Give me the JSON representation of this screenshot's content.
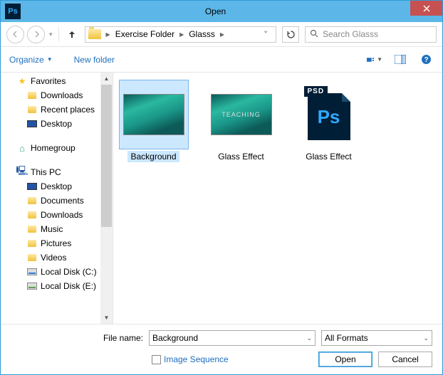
{
  "title": "Open",
  "breadcrumb": {
    "seg1": "Exercise Folder",
    "seg2": "Glasss"
  },
  "search": {
    "placeholder": "Search Glasss"
  },
  "toolbar": {
    "organize": "Organize",
    "new_folder": "New folder"
  },
  "tree": {
    "favorites": "Favorites",
    "downloads": "Downloads",
    "recent": "Recent places",
    "desktop": "Desktop",
    "homegroup": "Homegroup",
    "thispc": "This PC",
    "pc_desktop": "Desktop",
    "documents": "Documents",
    "pc_downloads": "Downloads",
    "music": "Music",
    "pictures": "Pictures",
    "videos": "Videos",
    "local_c": "Local Disk (C:)",
    "local_e": "Local Disk (E:)"
  },
  "files": [
    {
      "label": "Background",
      "kind": "image",
      "text": "",
      "selected": true
    },
    {
      "label": "Glass Effect",
      "kind": "image",
      "text": "TEACHING",
      "selected": false
    },
    {
      "label": "Glass Effect",
      "kind": "psd",
      "selected": false
    }
  ],
  "footer": {
    "filename_label": "File name:",
    "filename_value": "Background",
    "format_value": "All Formats",
    "image_sequence": "Image Sequence",
    "open": "Open",
    "cancel": "Cancel"
  }
}
